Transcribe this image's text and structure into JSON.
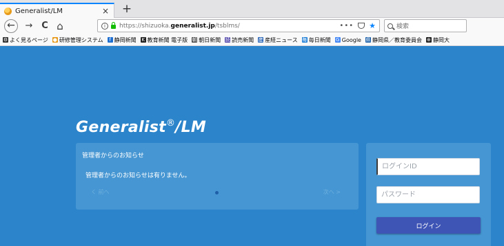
{
  "browser": {
    "tab": {
      "title": "Generalist/LM",
      "close": "×"
    },
    "new_tab": "+",
    "nav": {
      "back": "←",
      "forward": "→",
      "reload": "C",
      "home": "⌂"
    },
    "url": {
      "scheme": "https://",
      "host_prefix": "shizuoka.",
      "host": "generalist.jp",
      "path": "/tsblms/"
    },
    "page_actions": "•••",
    "search_placeholder": "検索",
    "bookmarks": [
      {
        "label": "よく見るページ",
        "icon": "gear-icon",
        "glyph": "⚙",
        "color": "#333333"
      },
      {
        "label": "研修管理システム",
        "icon": "generalist-icon",
        "glyph": "●",
        "color": "#e79a1a"
      },
      {
        "label": "静岡新聞",
        "icon": "shizuoka-news-icon",
        "glyph": "f",
        "color": "#1f6fd1"
      },
      {
        "label": "教育新聞 電子版",
        "icon": "kyoiku-news-icon",
        "glyph": "K",
        "color": "#222222"
      },
      {
        "label": "朝日新聞",
        "icon": "asahi-icon",
        "glyph": "朝",
        "color": "#444444"
      },
      {
        "label": "読売新聞",
        "icon": "yomiuri-icon",
        "glyph": "読",
        "color": "#4b3fa8"
      },
      {
        "label": "産経ニュース",
        "icon": "sankei-icon",
        "glyph": "産",
        "color": "#2a66b8"
      },
      {
        "label": "毎日新聞",
        "icon": "mainichi-icon",
        "glyph": "毎",
        "color": "#1f7fd6"
      },
      {
        "label": "Google",
        "icon": "google-icon",
        "glyph": "G",
        "color": "#4285f4"
      },
      {
        "label": "静岡県／教育委員会",
        "icon": "prefecture-icon",
        "glyph": "県",
        "color": "#1a5fa8"
      },
      {
        "label": "静岡大",
        "icon": "university-icon",
        "glyph": "⊕",
        "color": "#222222"
      }
    ]
  },
  "page": {
    "brand": "Generalist",
    "brand_mark": "®",
    "brand_suffix": "/LM",
    "notice": {
      "title": "管理者からのお知らせ",
      "body": "管理者からのお知らせは有りません。",
      "prev": "く 前へ",
      "next": "次へ >"
    },
    "login": {
      "id_placeholder": "ログインID",
      "password_placeholder": "パスワード",
      "button": "ログイン"
    }
  },
  "colors": {
    "background": "#2c85cb",
    "panel": "#4596d2",
    "login_button": "#3f55b5",
    "pager_dot": "#1f5fa8"
  }
}
